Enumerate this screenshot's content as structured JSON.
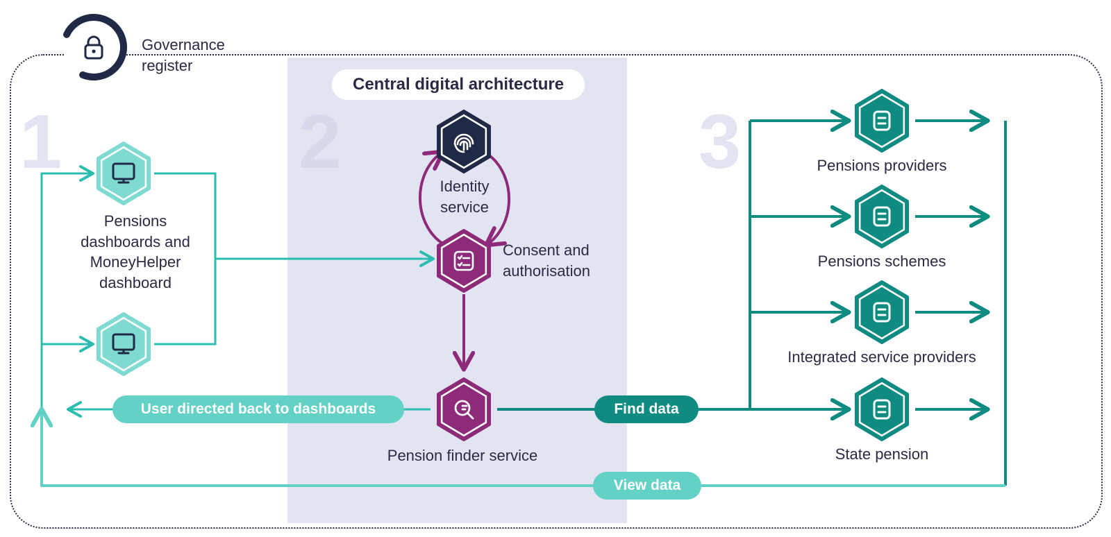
{
  "governance_label": "Governance register",
  "section_numbers": {
    "one": "1",
    "two": "2",
    "three": "3"
  },
  "cda_title": "Central digital architecture",
  "col1": {
    "dashboards_label": "Pensions dashboards and MoneyHelper dashboard"
  },
  "col2": {
    "identity_label": "Identity service",
    "consent_label": "Consent and authorisation",
    "pfs_label": "Pension finder service"
  },
  "col3": {
    "providers": "Pensions providers",
    "schemes": "Pensions schemes",
    "isp": "Integrated service providers",
    "state": "State pension"
  },
  "pills": {
    "user_back": "User directed back to dashboards",
    "find_data": "Find data",
    "view_data": "View data"
  },
  "colors": {
    "navy": "#202945",
    "frame": "#2a2a45",
    "cda_bg": "#e3e4f2",
    "teal_light": "#63d1c5",
    "teal_mid": "#2bbdaf",
    "teal_dark": "#0f8b81",
    "purple": "#8d2a7a"
  }
}
